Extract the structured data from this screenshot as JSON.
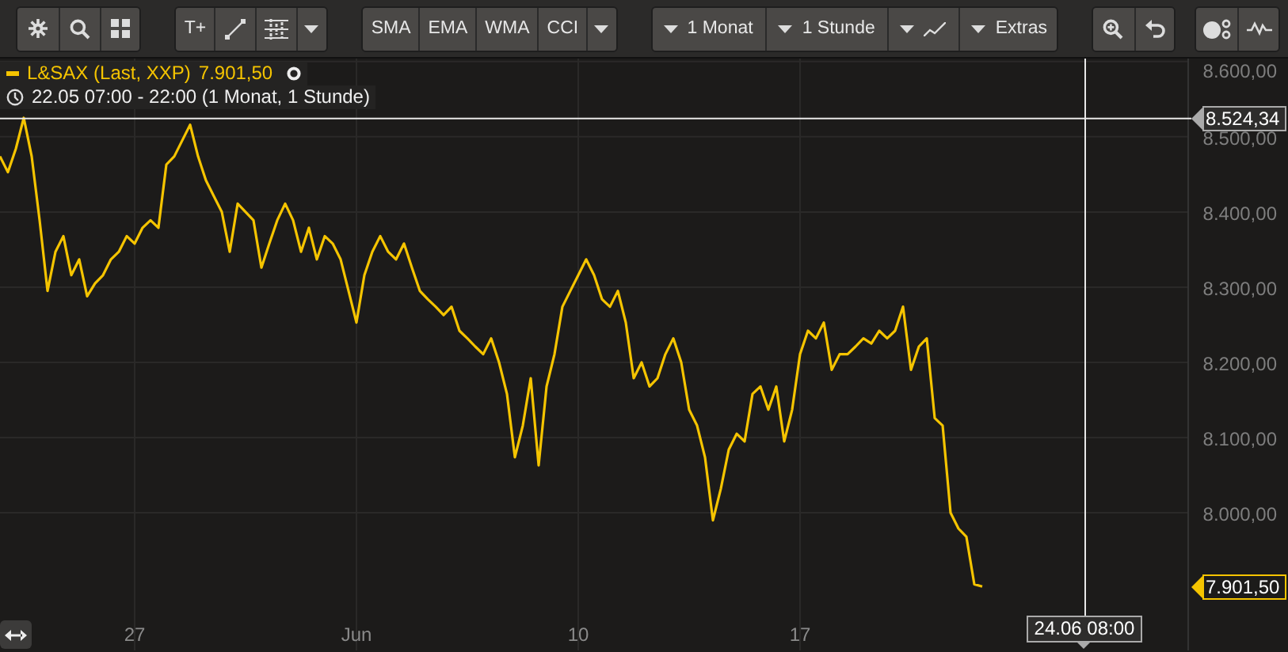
{
  "toolbar": {
    "groups": [
      {
        "items": [
          {
            "kind": "icon"
          },
          {
            "kind": "icon"
          },
          {
            "kind": "icon"
          }
        ]
      },
      {
        "items": [
          {
            "kind": "text",
            "label": "T+"
          },
          {
            "kind": "icon"
          },
          {
            "kind": "icon"
          },
          {
            "kind": "caret"
          }
        ]
      },
      {
        "items": [
          {
            "kind": "text",
            "label": "SMA"
          },
          {
            "kind": "text",
            "label": "EMA"
          },
          {
            "kind": "text",
            "label": "WMA"
          },
          {
            "kind": "text",
            "label": "CCI"
          },
          {
            "kind": "caret"
          }
        ]
      },
      {
        "items": [
          {
            "kind": "menu",
            "label": "1 Monat"
          },
          {
            "kind": "menu",
            "label": "1 Stunde"
          },
          {
            "kind": "menu-icon"
          },
          {
            "kind": "menu",
            "label": "Extras"
          }
        ]
      },
      {
        "items": [
          {
            "kind": "icon"
          },
          {
            "kind": "icon"
          }
        ]
      },
      {
        "items": [
          {
            "kind": "icon"
          },
          {
            "kind": "icon"
          }
        ]
      }
    ]
  },
  "crosshair": {
    "date_label": "24.06 08:00"
  },
  "legend": {
    "last_value": "7.901,50",
    "period": "22.05 07:00 - 22:00 (1 Monat, 1 Stunde)"
  },
  "last_price_label": "7.901,50",
  "chart_data": {
    "type": "line",
    "grid": true,
    "ylim": [
      7817,
      8604
    ],
    "yticks": [
      {
        "value": 8600,
        "label": "8.600,00"
      },
      {
        "value": 8500,
        "label": "8.500,00"
      },
      {
        "value": 8400,
        "label": "8.400,00"
      },
      {
        "value": 8300,
        "label": "8.300,00"
      },
      {
        "value": 8200,
        "label": "8.200,00"
      },
      {
        "value": 8100,
        "label": "8.100,00"
      },
      {
        "value": 8000,
        "label": "8.000,00"
      }
    ],
    "ref_lines": [
      {
        "axis": "y",
        "value": 8524.34,
        "label": "8.524,34"
      }
    ],
    "categories": [
      null,
      null,
      null,
      null,
      null,
      null,
      null,
      null,
      null,
      null,
      null,
      null,
      null,
      null,
      null,
      null,
      null,
      "27",
      null,
      null,
      null,
      null,
      null,
      null,
      null,
      null,
      null,
      null,
      null,
      null,
      null,
      null,
      null,
      null,
      null,
      null,
      null,
      null,
      null,
      null,
      null,
      null,
      null,
      null,
      null,
      "Jun",
      null,
      null,
      null,
      null,
      null,
      null,
      null,
      null,
      null,
      null,
      null,
      null,
      null,
      null,
      null,
      null,
      null,
      null,
      null,
      null,
      null,
      null,
      null,
      null,
      null,
      null,
      null,
      "10",
      null,
      null,
      null,
      null,
      null,
      null,
      null,
      null,
      null,
      null,
      null,
      null,
      null,
      null,
      null,
      null,
      null,
      null,
      null,
      null,
      null,
      null,
      null,
      null,
      null,
      null,
      null,
      "17",
      null,
      null,
      null,
      null,
      null,
      null,
      null,
      null,
      null,
      null,
      null,
      null,
      null,
      null,
      null,
      null,
      null,
      null,
      null,
      null,
      null,
      null,
      null
    ],
    "series": [
      {
        "name": "L&SAX (Last, XXP)",
        "color": "#f5c400",
        "values": [
          8474,
          8453,
          8484,
          8525,
          8474,
          8389,
          8295,
          8347,
          8368,
          8316,
          8337,
          8288,
          8305,
          8316,
          8337,
          8347,
          8368,
          8358,
          8379,
          8389,
          8379,
          8463,
          8474,
          8495,
          8516,
          8474,
          8442,
          8421,
          8400,
          8347,
          8411,
          8400,
          8389,
          8326,
          8358,
          8389,
          8411,
          8389,
          8347,
          8379,
          8337,
          8368,
          8358,
          8337,
          8295,
          8253,
          8316,
          8347,
          8368,
          8347,
          8337,
          8358,
          8326,
          8295,
          8284,
          8274,
          8263,
          8274,
          8242,
          8232,
          8221,
          8211,
          8232,
          8200,
          8158,
          8074,
          8116,
          8179,
          8063,
          8168,
          8211,
          8274,
          8295,
          8316,
          8337,
          8316,
          8284,
          8274,
          8295,
          8253,
          8179,
          8200,
          8168,
          8179,
          8211,
          8232,
          8200,
          8137,
          8116,
          8074,
          7990,
          8032,
          8084,
          8105,
          8095,
          8158,
          8168,
          8137,
          8168,
          8095,
          8137,
          8211,
          8242,
          8232,
          8253,
          8190,
          8211,
          8211,
          8221,
          8232,
          8225,
          8242,
          8232,
          8242,
          8274,
          8190,
          8221,
          8232,
          8126,
          8116,
          8000,
          7979,
          7968,
          7905,
          7902
        ]
      }
    ]
  }
}
